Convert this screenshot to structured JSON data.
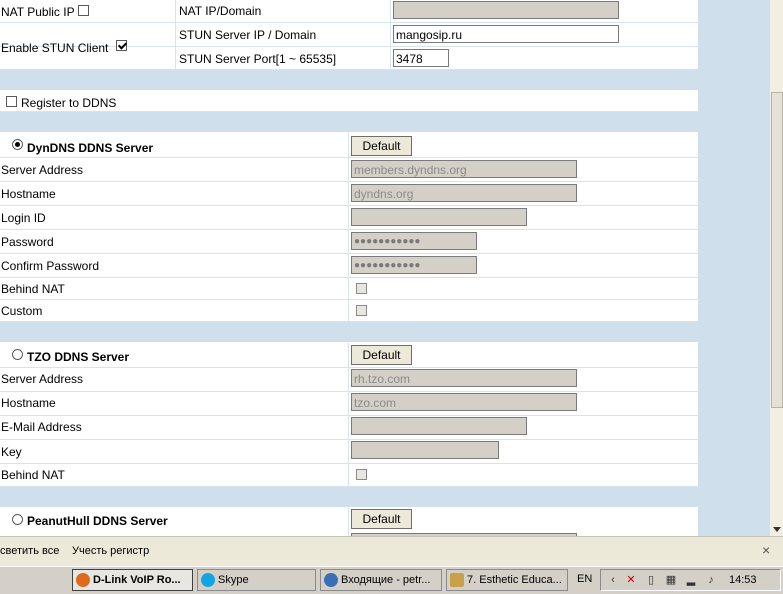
{
  "nat": {
    "public_ip_label": "NAT Public IP",
    "ip_domain_label": "NAT IP/Domain",
    "ip_domain_value": "",
    "stun_client_label": "Enable STUN Client",
    "stun_server_label": "STUN Server IP / Domain",
    "stun_server_value": "mangosip.ru",
    "stun_port_label": "STUN Server Port[1 ~ 65535]",
    "stun_port_value": "3478"
  },
  "ddns": {
    "register_label": "Register to DDNS"
  },
  "dyndns": {
    "title": "DynDNS DDNS Server",
    "default_button": "Default",
    "server_address_label": "Server Address",
    "server_address_value": "members.dyndns.org",
    "hostname_label": "Hostname",
    "hostname_value": "dyndns.org",
    "login_label": "Login ID",
    "login_value": "",
    "password_label": "Password",
    "password_value": "●●●●●●●●●●●",
    "confirm_label": "Confirm Password",
    "confirm_value": "●●●●●●●●●●●",
    "behind_nat_label": "Behind NAT",
    "custom_label": "Custom"
  },
  "tzo": {
    "title": "TZO DDNS Server",
    "default_button": "Default",
    "server_address_label": "Server Address",
    "server_address_value": "rh.tzo.com",
    "hostname_label": "Hostname",
    "hostname_value": "tzo.com",
    "email_label": "E-Mail Address",
    "email_value": "",
    "key_label": "Key",
    "key_value": "",
    "behind_nat_label": "Behind NAT"
  },
  "peanut": {
    "title": "PeanutHull DDNS Server",
    "default_button": "Default"
  },
  "findbar": {
    "highlight_all": "светить все",
    "match_case": "Учесть регистр",
    "close": "×"
  },
  "taskbar": {
    "tasks": [
      {
        "label": "D-Link VoIP Ro...",
        "icon": "firefox-icon",
        "color": "#e06a1c"
      },
      {
        "label": "Skype",
        "icon": "skype-icon",
        "color": "#12a5e4"
      },
      {
        "label": "Входящие - petr...",
        "icon": "thunderbird-icon",
        "color": "#3a6fb3"
      },
      {
        "label": "7. Esthetic Educa...",
        "icon": "document-icon",
        "color": "#c9a14b"
      }
    ],
    "lang": "EN",
    "clock": "14:53"
  }
}
